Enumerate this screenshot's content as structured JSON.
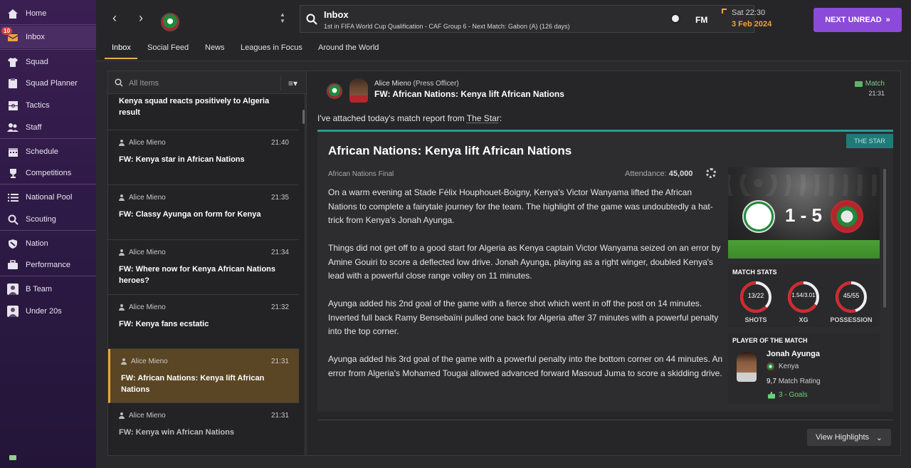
{
  "sidebar": {
    "items": [
      {
        "label": "Home",
        "icon": "home-icon"
      },
      {
        "label": "Inbox",
        "icon": "inbox-icon",
        "badge": "10"
      },
      {
        "label": "Squad",
        "icon": "shirt-icon"
      },
      {
        "label": "Squad Planner",
        "icon": "clipboard-icon"
      },
      {
        "label": "Tactics",
        "icon": "tactics-icon"
      },
      {
        "label": "Staff",
        "icon": "staff-icon"
      },
      {
        "label": "Schedule",
        "icon": "calendar-icon"
      },
      {
        "label": "Competitions",
        "icon": "trophy-icon"
      },
      {
        "label": "National Pool",
        "icon": "list-icon"
      },
      {
        "label": "Scouting",
        "icon": "search-icon"
      },
      {
        "label": "Nation",
        "icon": "shield-icon"
      },
      {
        "label": "Performance",
        "icon": "briefcase-icon"
      },
      {
        "label": "B Team",
        "icon": "b-team-icon"
      },
      {
        "label": "Under 20s",
        "icon": "u20-icon"
      }
    ]
  },
  "header": {
    "title": "Inbox",
    "subtitle": "1st in FIFA World Cup Qualification - CAF Group 6 - Next Match: Gabon (A) (126 days)",
    "fm_label": "FM",
    "time": "Sat 22:30",
    "date": "3 Feb 2024",
    "next_unread": "NEXT UNREAD"
  },
  "tabs": [
    "Inbox",
    "Social Feed",
    "News",
    "Leagues in Focus",
    "Around the World"
  ],
  "list": {
    "search_placeholder": "All Items",
    "partial_item": "Kenya squad reacts positively to Algeria result",
    "items": [
      {
        "from": "Alice Mieno",
        "time": "21:40",
        "subject": "FW: Kenya star in African Nations"
      },
      {
        "from": "Alice Mieno",
        "time": "21:35",
        "subject": "FW: Classy Ayunga on form for Kenya"
      },
      {
        "from": "Alice Mieno",
        "time": "21:34",
        "subject": "FW: Where now for Kenya African Nations heroes?"
      },
      {
        "from": "Alice Mieno",
        "time": "21:32",
        "subject": "FW: Kenya fans ecstatic"
      },
      {
        "from": "Alice Mieno",
        "time": "21:31",
        "subject": "FW: African Nations: Kenya lift African Nations"
      },
      {
        "from": "Alice Mieno",
        "time": "21:31",
        "subject": "FW: Kenya win African Nations"
      }
    ]
  },
  "message": {
    "sender": "Alice Mieno",
    "role": "(Press Officer)",
    "subject": "FW: African Nations: Kenya lift African Nations",
    "tag": "Match",
    "time": "21:31",
    "intro_prefix": "I've attached today's match report from ",
    "intro_source": "The Star",
    "intro_suffix": ":"
  },
  "article": {
    "source_tag": "THE STAR",
    "title": "African Nations: Kenya lift African Nations",
    "competition": "African Nations Final",
    "attendance_label": "Attendance:",
    "attendance": "45,000",
    "paragraphs": [
      "On a warm evening at Stade Félix Houphouet-Boigny, Kenya's Victor Wanyama lifted the African Nations to complete a fairytale journey for the team. The highlight of the game was undoubtedly a hat-trick from Kenya's Jonah Ayunga.",
      "Things did not get off to a good start for Algeria as Kenya captain Victor Wanyama seized on an error by Amine Gouiri to score a deflected low drive. Jonah Ayunga, playing as a right winger, doubled Kenya's lead with a powerful close range volley on 11 minutes.",
      "Ayunga added his 2nd goal of the game with a fierce shot which went in off the post on 14 minutes. Inverted full back Ramy Bensebaïni pulled one back for Algeria after 37 minutes with a powerful penalty into the top corner.",
      "Ayunga added his 3rd goal of the game with a powerful penalty into the bottom corner on 44 minutes. An error from Algeria's Mohamed Tougai allowed advanced forward Masoud Juma to score a skidding drive."
    ],
    "score": "1 - 5",
    "match_stats_label": "MATCH STATS",
    "stats": [
      {
        "label": "SHOTS",
        "value": "13/22",
        "home": 13,
        "away": 22
      },
      {
        "label": "XG",
        "value": "1.54/3.01",
        "home": 1.54,
        "away": 3.01
      },
      {
        "label": "POSSESSION",
        "value": "45/55",
        "home": 45,
        "away": 55
      }
    ],
    "potm_label": "PLAYER OF THE MATCH",
    "potm": {
      "name": "Jonah Ayunga",
      "nation": "Kenya",
      "rating": "9,7",
      "rating_label": "Match Rating",
      "goals": "3 - Goals"
    }
  },
  "footer": {
    "highlights": "View Highlights"
  },
  "colors": {
    "accent": "#8c4ad9",
    "date": "#f0a43a",
    "selected": "#5a4524",
    "ring": "#d8262c",
    "teal": "#2a9b97"
  }
}
